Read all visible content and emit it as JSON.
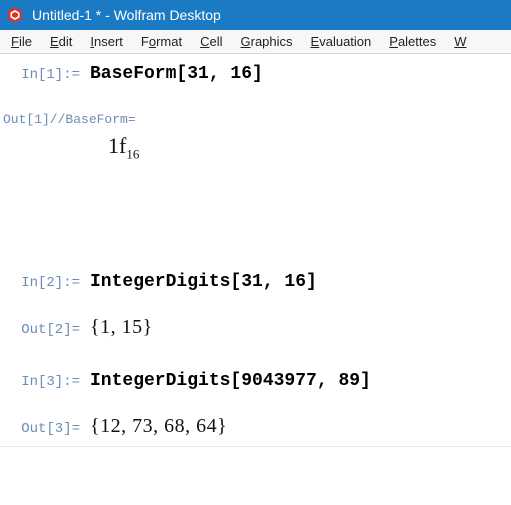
{
  "window": {
    "title": "Untitled-1 * - Wolfram Desktop"
  },
  "menu": {
    "file": {
      "ul": "F",
      "rest": "ile"
    },
    "edit": {
      "ul": "E",
      "rest": "dit"
    },
    "insert": {
      "ul": "I",
      "rest": "nsert"
    },
    "format": {
      "pre": "F",
      "ul": "o",
      "rest": "rmat"
    },
    "cell": {
      "ul": "C",
      "rest": "ell"
    },
    "graphics": {
      "ul": "G",
      "rest": "raphics"
    },
    "evaluation": {
      "ul": "E",
      "rest": "valuation"
    },
    "palettes": {
      "ul": "P",
      "rest": "alettes"
    },
    "window": {
      "ul": "W",
      "rest": ""
    }
  },
  "cells": {
    "in1_label": "In[1]:=",
    "in1_code": "BaseForm[31, 16]",
    "out1_header": "Out[1]//BaseForm=",
    "out1_main": "1f",
    "out1_sub": "16",
    "in2_label": "In[2]:=",
    "in2_code": "IntegerDigits[31, 16]",
    "out2_label": "Out[2]=",
    "out2_value": "{1, 15}",
    "in3_label": "In[3]:=",
    "in3_code": "IntegerDigits[9043977, 89]",
    "out3_label": "Out[3]=",
    "out3_value": "{12, 73, 68, 64}"
  }
}
